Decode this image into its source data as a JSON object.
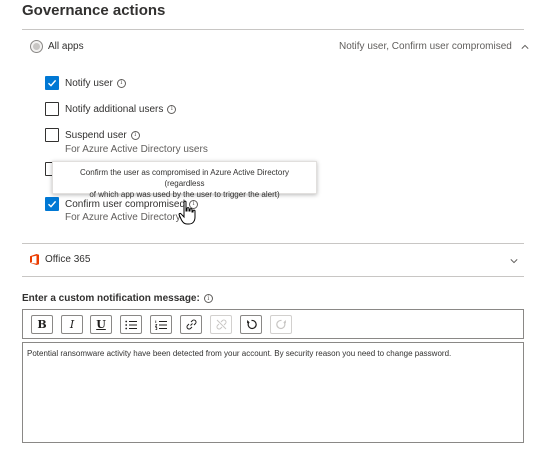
{
  "heading": "Governance actions",
  "all_apps": {
    "label": "All apps",
    "summary": "Notify user, Confirm user compromised"
  },
  "actions": [
    {
      "label": "Notify user",
      "checked": true
    },
    {
      "label": "Notify additional users",
      "checked": false
    },
    {
      "label": "Suspend user",
      "checked": false,
      "sub": "For Azure Active Directory users"
    },
    {
      "label": "Confirm user compromised",
      "checked": true,
      "sub": "For Azure Active Directory us"
    }
  ],
  "tooltip": {
    "line1": "Confirm the user as compromised in Azure Active Directory (regardless",
    "line2": "of which app was used by the user to trigger the alert)"
  },
  "office": {
    "label": "Office 365"
  },
  "custom_message": {
    "label": "Enter a custom notification message:",
    "text": "Potential ransomware activity have been detected from your account. By security reason you need to change password."
  },
  "toolbar": {
    "bold": "B",
    "italic": "I",
    "underline": "U"
  },
  "colors": {
    "accent": "#0078d4",
    "office": "#eb3c00"
  }
}
